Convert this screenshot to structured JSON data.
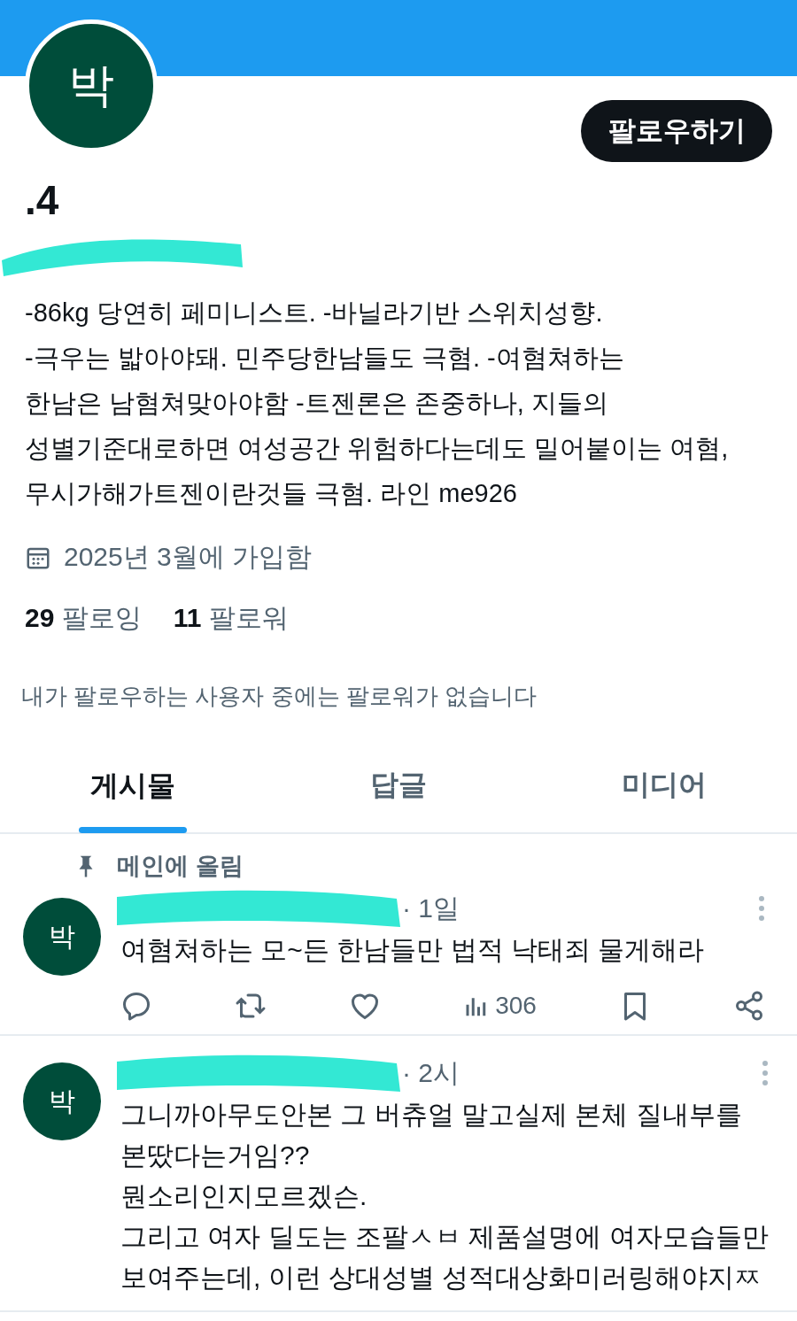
{
  "profile": {
    "avatar_letter": "박",
    "follow_button": "팔로우하기",
    "name": ".4",
    "bio_lines": [
      "-86kg 당연히 페미니스트.  -바닐라기반 스위치성향.",
      "-극우는 밟아야돼. 민주당한남들도 극혐. -여혐쳐하는",
      "한남은 남혐쳐맞아야함 -트젠론은 존중하나, 지들의",
      "성별기준대로하면 여성공간 위험하다는데도 밀어붙이는 여혐,",
      "무시가해가트젠이란것들 극혐. 라인 me926"
    ],
    "joined": "2025년 3월에 가입함",
    "following": {
      "count": "29",
      "label": "팔로잉"
    },
    "followers": {
      "count": "11",
      "label": "팔로워"
    },
    "followed_by_note": "내가 팔로우하는 사용자 중에는 팔로워가 없습니다"
  },
  "tabs": [
    {
      "label": "게시물",
      "selected": true
    },
    {
      "label": "답글",
      "selected": false
    },
    {
      "label": "미디어",
      "selected": false
    }
  ],
  "posts": [
    {
      "pinned_label": "메인에 올림",
      "avatar_letter": "박",
      "meta": "· 1일",
      "text_lines": [
        "여혐쳐하는 모~든 한남들만 법적 낙태죄 물게해라"
      ],
      "views": "306"
    },
    {
      "avatar_letter": "박",
      "meta": "· 2시",
      "text_lines": [
        "그니까아무도안본 그 버츄얼 말고실제 본체 질내부를",
        "본땄다는거임??",
        "뭔소리인지모르겠슨.",
        "그리고 여자 딜도는 조팔ㅅㅂ 제품설명에 여자모습들만",
        "보여주는데, 이런 상대성별 성적대상화미러링해야지ㅉ"
      ]
    }
  ]
}
